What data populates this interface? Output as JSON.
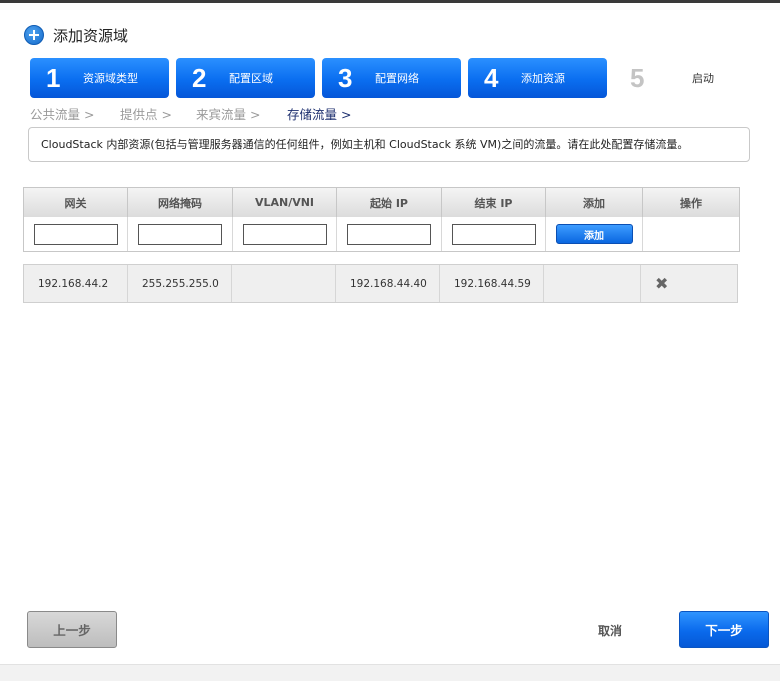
{
  "dialog": {
    "title": "添加资源域",
    "icon": "plus-circle-icon"
  },
  "steps": [
    {
      "number": "1",
      "label": "资源域类型"
    },
    {
      "number": "2",
      "label": "配置区域"
    },
    {
      "number": "3",
      "label": "配置网络"
    },
    {
      "number": "4",
      "label": "添加资源"
    },
    {
      "number": "5",
      "label": "启动"
    }
  ],
  "subnav": [
    {
      "label": "公共流量 >",
      "active": false
    },
    {
      "label": "提供点 >",
      "active": false
    },
    {
      "label": "来宾流量 >",
      "active": false
    },
    {
      "label": "存储流量 >",
      "active": true
    }
  ],
  "description": "CloudStack 内部资源(包括与管理服务器通信的任何组件，例如主机和 CloudStack 系统 VM)之间的流量。请在此处配置存储流量。",
  "table": {
    "headers": [
      "网关",
      "网络掩码",
      "VLAN/VNI",
      "起始 IP",
      "结束 IP",
      "添加",
      "操作"
    ],
    "inputs": {
      "gateway": "",
      "netmask": "",
      "vlan": "",
      "start_ip": "",
      "end_ip": ""
    },
    "add_button": "添加",
    "rows": [
      {
        "gateway": "192.168.44.2",
        "netmask": "255.255.255.0",
        "vlan": "",
        "start_ip": "192.168.44.40",
        "end_ip": "192.168.44.59",
        "action_icon": "delete-x-icon"
      }
    ]
  },
  "footer": {
    "prev_label": "上一步",
    "cancel_label": "取消",
    "next_label": "下一步"
  },
  "colors": {
    "accent": "#0a6ef0",
    "active_nav": "#1c2e6e",
    "disabled_step": "#c4c4c4"
  }
}
